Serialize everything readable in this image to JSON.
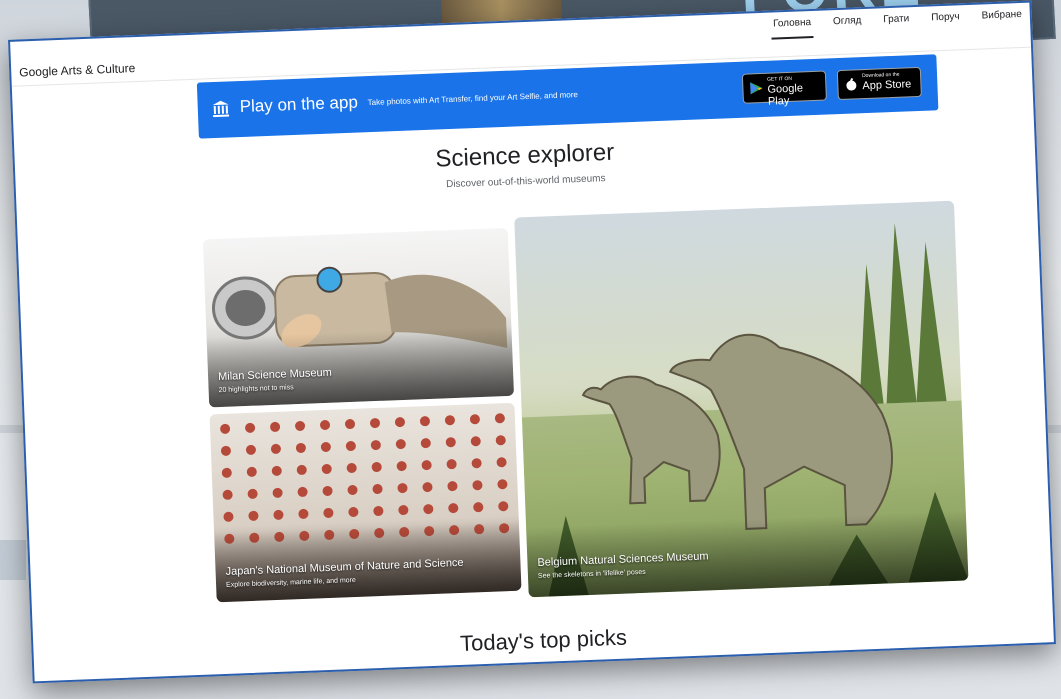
{
  "background": {
    "heading_fragment": "FORE"
  },
  "header": {
    "logo": "Google Arts & Culture",
    "nav": [
      "Головна",
      "Огляд",
      "Грати",
      "Поруч",
      "Вибране"
    ],
    "active_nav_index": 0
  },
  "banner": {
    "icon": "museum-icon",
    "title": "Play on the app",
    "subtitle": "Take photos with Art Transfer, find your Art Selfie, and more",
    "google_play": {
      "small": "GET IT ON",
      "big": "Google Play"
    },
    "app_store": {
      "small": "Download on the",
      "big": "App Store"
    },
    "color": "#1a73e8"
  },
  "section": {
    "title": "Science explorer",
    "subtitle": "Discover out-of-this-world museums"
  },
  "cards": [
    {
      "title": "Milan Science Museum",
      "subtitle": "20 highlights not to miss"
    },
    {
      "title": "Japan's National Museum of Nature and Science",
      "subtitle": "Explore biodiversity, marine life, and more"
    },
    {
      "title": "Belgium Natural Sciences Museum",
      "subtitle": "See the skeletons in 'lifelike' poses"
    }
  ],
  "next_section": {
    "title": "Today's top picks"
  }
}
